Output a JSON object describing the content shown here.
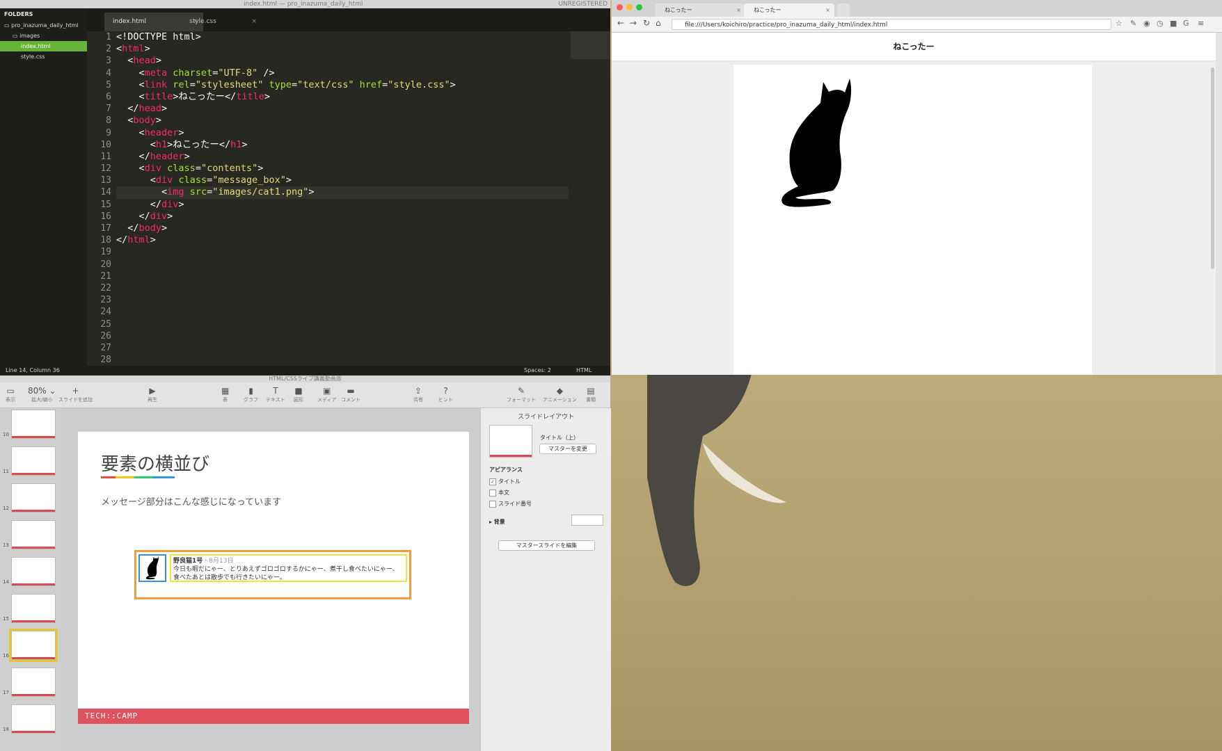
{
  "editor": {
    "window_title": "index.html — pro_inazuma_daily_html",
    "unregistered": "UNREGISTERED",
    "sidebar": {
      "header": "FOLDERS",
      "items": [
        {
          "label": "pro_inazuma_daily_html"
        },
        {
          "label": "images"
        },
        {
          "label": "index.html"
        },
        {
          "label": "style.css"
        }
      ]
    },
    "tabs": [
      {
        "label": "index.html",
        "close": "×"
      },
      {
        "label": "style.css",
        "close": "×"
      }
    ],
    "line_numbers": [
      "1",
      "2",
      "3",
      "4",
      "5",
      "6",
      "7",
      "8",
      "9",
      "10",
      "11",
      "12",
      "13",
      "14",
      "15",
      "16",
      "17",
      "18",
      "19",
      "20",
      "21",
      "22",
      "23",
      "24",
      "25",
      "26",
      "27",
      "28"
    ],
    "status": {
      "position": "Line 14, Column 36",
      "spaces": "Spaces: 2",
      "syntax": "HTML"
    }
  },
  "code_tokens": [
    [
      [
        "pu",
        "<!DOCTYPE html>"
      ]
    ],
    [
      [
        "pu",
        "<"
      ],
      [
        "tg",
        "html"
      ],
      [
        "pu",
        ">"
      ]
    ],
    [
      [
        "pu",
        "  <"
      ],
      [
        "tg",
        "head"
      ],
      [
        "pu",
        ">"
      ]
    ],
    [
      [
        "pu",
        "    <"
      ],
      [
        "tg",
        "meta"
      ],
      [
        "pu",
        " "
      ],
      [
        "at",
        "charset"
      ],
      [
        "pu",
        "="
      ],
      [
        "st",
        "\"UTF-8\""
      ],
      [
        "pu",
        " />"
      ]
    ],
    [
      [
        "pu",
        "    <"
      ],
      [
        "tg",
        "link"
      ],
      [
        "pu",
        " "
      ],
      [
        "at",
        "rel"
      ],
      [
        "pu",
        "="
      ],
      [
        "st",
        "\"stylesheet\""
      ],
      [
        "pu",
        " "
      ],
      [
        "at",
        "type"
      ],
      [
        "pu",
        "="
      ],
      [
        "st",
        "\"text/css\""
      ],
      [
        "pu",
        " "
      ],
      [
        "at",
        "href"
      ],
      [
        "pu",
        "="
      ],
      [
        "st",
        "\"style.css\""
      ],
      [
        "pu",
        ">"
      ]
    ],
    [
      [
        "pu",
        "    <"
      ],
      [
        "tg",
        "title"
      ],
      [
        "pu",
        ">ねこったー</"
      ],
      [
        "tg",
        "title"
      ],
      [
        "pu",
        ">"
      ]
    ],
    [
      [
        "pu",
        "  </"
      ],
      [
        "tg",
        "head"
      ],
      [
        "pu",
        ">"
      ]
    ],
    [
      [
        "pu",
        "  <"
      ],
      [
        "tg",
        "body"
      ],
      [
        "pu",
        ">"
      ]
    ],
    [
      [
        "pu",
        "    <"
      ],
      [
        "tg",
        "header"
      ],
      [
        "pu",
        ">"
      ]
    ],
    [
      [
        "pu",
        "      <"
      ],
      [
        "tg",
        "h1"
      ],
      [
        "pu",
        ">ねこったー</"
      ],
      [
        "tg",
        "h1"
      ],
      [
        "pu",
        ">"
      ]
    ],
    [
      [
        "pu",
        "    </"
      ],
      [
        "tg",
        "header"
      ],
      [
        "pu",
        ">"
      ]
    ],
    [
      [
        "pu",
        "    <"
      ],
      [
        "tg",
        "div"
      ],
      [
        "pu",
        " "
      ],
      [
        "at",
        "class"
      ],
      [
        "pu",
        "="
      ],
      [
        "st",
        "\"contents\""
      ],
      [
        "pu",
        ">"
      ]
    ],
    [
      [
        "pu",
        "      <"
      ],
      [
        "tg",
        "div"
      ],
      [
        "pu",
        " "
      ],
      [
        "at",
        "class"
      ],
      [
        "pu",
        "="
      ],
      [
        "st",
        "\"message_box\""
      ],
      [
        "pu",
        ">"
      ]
    ],
    [
      [
        "pu",
        "        <"
      ],
      [
        "tg",
        "img"
      ],
      [
        "pu",
        " "
      ],
      [
        "at",
        "src"
      ],
      [
        "pu",
        "="
      ],
      [
        "st",
        "\"images/cat1.png\""
      ],
      [
        "pu",
        ">"
      ]
    ],
    [
      [
        "pu",
        "      </"
      ],
      [
        "tg",
        "div"
      ],
      [
        "pu",
        ">"
      ]
    ],
    [
      [
        "pu",
        "    </"
      ],
      [
        "tg",
        "div"
      ],
      [
        "pu",
        ">"
      ]
    ],
    [
      [
        "pu",
        "  </"
      ],
      [
        "tg",
        "body"
      ],
      [
        "pu",
        ">"
      ]
    ],
    [
      [
        "pu",
        "</"
      ],
      [
        "tg",
        "html"
      ],
      [
        "pu",
        ">"
      ]
    ]
  ],
  "browser": {
    "tabs": [
      {
        "label": "ねこったー",
        "close": "×"
      },
      {
        "label": "ねこったー",
        "close": "×"
      }
    ],
    "url": "file:///Users/koichiro/practice/pro_inazuma_daily_html/index.html",
    "page_heading": "ねこったー",
    "nav_icons": [
      "back-icon",
      "forward-icon",
      "reload-icon",
      "home-icon"
    ],
    "nav_glyphs": [
      "←",
      "→",
      "↻",
      "⌂"
    ]
  },
  "keynote": {
    "window_title": "HTML/CSSライブ講義動画版",
    "toolbar": [
      {
        "icon": "▭",
        "label": "表示"
      },
      {
        "icon": "80% ⌄",
        "label": "拡大/縮小"
      },
      {
        "icon": "+",
        "label": "スライドを追加"
      },
      {
        "icon": "▶",
        "label": "再生"
      },
      {
        "icon": "▦",
        "label": "表"
      },
      {
        "icon": "▮",
        "label": "グラフ"
      },
      {
        "icon": "T",
        "label": "テキスト"
      },
      {
        "icon": "■",
        "label": "図形"
      },
      {
        "icon": "▣",
        "label": "メディア"
      },
      {
        "icon": "▬",
        "label": "コメント"
      },
      {
        "icon": "⇪",
        "label": "共有"
      },
      {
        "icon": "?",
        "label": "ヒント"
      },
      {
        "icon": "✎",
        "label": "フォーマット"
      },
      {
        "icon": "◆",
        "label": "アニメーション"
      },
      {
        "icon": "▤",
        "label": "書類"
      }
    ],
    "slide_numbers": [
      "10",
      "11",
      "12",
      "13",
      "14",
      "15",
      "16",
      "17",
      "18"
    ],
    "slide": {
      "title": "要素の横並び",
      "body": "メッセージ部分はこんな感じになっています",
      "message": {
        "name": "野良猫1号",
        "date": "・8月13日",
        "text": "今日も暇だにゃー、とりあえずゴロゴロするかにゃー、煮干し食べたいにゃー、食べたあとは散歩でも行きたいにゃー。"
      },
      "footer": "TECH::CAMP"
    },
    "inspector": {
      "heading": "スライドレイアウト",
      "layout_name": "タイトル（上）",
      "change_master": "マスターを変更",
      "appearance_heading": "アピアランス",
      "checkboxes": [
        {
          "label": "タイトル",
          "checked": true
        },
        {
          "label": "本文",
          "checked": false
        },
        {
          "label": "スライド番号",
          "checked": false
        }
      ],
      "background_heading": "▸ 背景",
      "edit_master": "マスタースライドを編集"
    }
  }
}
